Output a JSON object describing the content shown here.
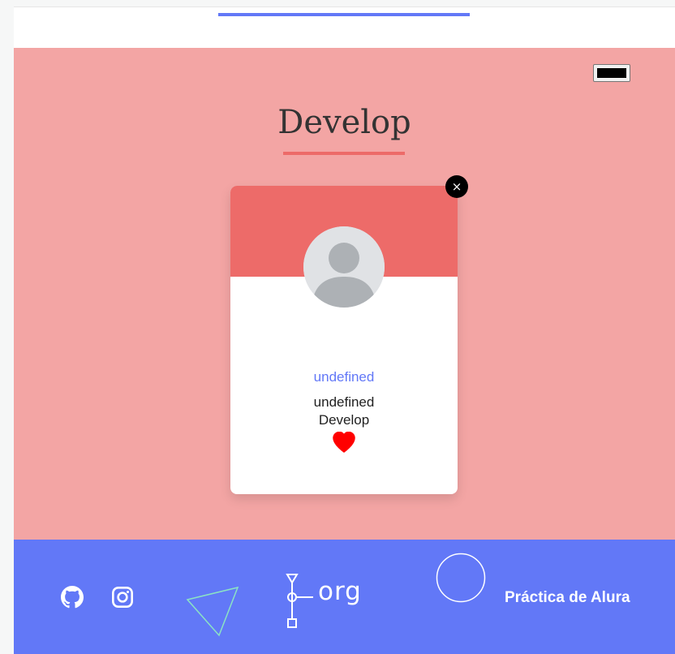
{
  "colors": {
    "section_background": "#f3a5a4",
    "accent": "#ed6b69",
    "primary": "#6278f7",
    "footer_background": "#6278f7",
    "heart": "#ff0000"
  },
  "team": {
    "title": "Develop"
  },
  "card": {
    "name": "undefined",
    "role": "undefined",
    "team": "Develop",
    "favorite": true,
    "close_label": "×",
    "avatar_icon": "user-placeholder-icon"
  },
  "footer": {
    "social_icons": [
      "github-icon",
      "instagram-icon"
    ],
    "logo_text": "org",
    "credit": "Práctica de Alura"
  }
}
